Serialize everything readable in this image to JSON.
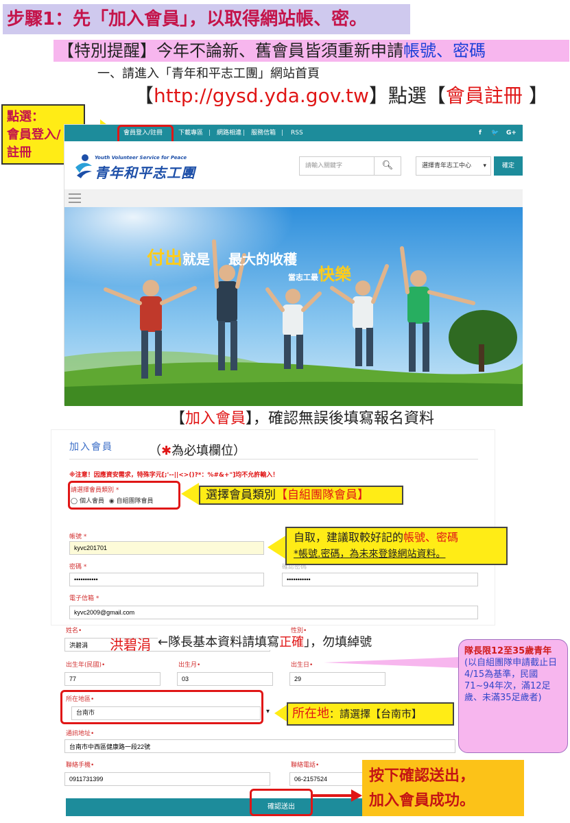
{
  "header": {
    "step_title": "步驟1：先「加入會員」，以取得網站帳、密。",
    "notice_prefix": "【特別提醒】今年不論新、舊會員皆須重新申請",
    "notice_highlight": "帳號、密碼",
    "instruction_1": "一、請進入「青年和平志工團」網站首頁",
    "url_open": "【",
    "url": "http://gysd.yda.gov.tw",
    "url_close": "】點選【",
    "register_label": "會員註冊",
    "register_close": " 】"
  },
  "callout_login": {
    "line1": "點選：",
    "line2": "會員登入/",
    "line3": "註冊"
  },
  "site": {
    "nav": [
      "會員登入/註冊",
      "下載專區",
      "網路相連",
      "服務信箱",
      "RSS"
    ],
    "social": [
      "f",
      "🐦",
      "G+"
    ],
    "logo_sub": "Youth Volunteer Service for Peace",
    "logo_text": "青年和平志工團",
    "search_placeholder": "請輸入關鍵字",
    "center_select": "選擇青年志工中心",
    "confirm": "確定",
    "slogan_1": "付出",
    "slogan_2": "就是",
    "slogan_3": "最大的收穫",
    "slogan_4": "當志工最",
    "slogan_5": "快樂"
  },
  "form_section": {
    "title_open": "【",
    "title_red": "加入會員",
    "title_rest": "】，確認無誤後填寫報名資料",
    "form_head": "加入會員",
    "required_note_open": "（",
    "required_note": "為必填欄位）",
    "warning": "※注意！因應資安需求，特殊字元[;'--||<>()?*：%#&+\"]均不允許輸入！",
    "member_type_label": "請選擇會員類別",
    "radio_individual": "個人會員",
    "radio_team": "自組團隊會員",
    "account_label": "帳號",
    "account_value": "kyvc201701",
    "password_label": "密碼",
    "password_value": "•••••••••••",
    "confirm_password_label": "確認密碼",
    "confirm_password_value": "•••••••••••",
    "email_label": "電子信箱",
    "email_value": "kyvc2009@gmail.com"
  },
  "callouts": {
    "member_type_1": "選擇會員類別",
    "member_type_2": "【自組團隊會員】",
    "account_1": "自取，建議取較好記的",
    "account_2": "帳號、密碼",
    "account_3": "*帳號.密碼，為未來登錄網站資料。",
    "name_red": "洪碧涓",
    "name_note_1": "←隊長基本資料請填寫",
    "name_note_2": "正確",
    "name_note_3": "」，勿填綽號",
    "location_1": "所在地",
    "location_2": "：請選擇【台南市】",
    "bubble_1": "隊長",
    "bubble_2": "限12至35歲青年",
    "bubble_3": "(以自組團隊申請截止日4/15為基準，民國71~94年次，滿12足歲、未滿35足歲者)",
    "final_1": "按下確認送出，",
    "final_2": "加入會員成功。"
  },
  "lower_form": {
    "name_label": "姓名",
    "name_value": "洪碧涓",
    "gender_label": "性別",
    "year_label": "出生年(民國)",
    "year_value": "77",
    "month_label": "出生月",
    "month_value": "03",
    "day_label": "出生日",
    "day_value": "29",
    "region_label": "所在地區",
    "region_value": "台南市",
    "address_label": "通訊地址",
    "address_value": "台南市中西區健康路一段22號",
    "mobile_label": "聯絡手機",
    "mobile_value": "0911731399",
    "phone_label": "聯絡電話",
    "phone_value": "06-2157524",
    "submit": "確認送出"
  },
  "colors": {
    "teal": "#1d8c9b",
    "red": "#e01616",
    "yellow": "#ffec16",
    "pink": "#f7b6ee",
    "lavender": "#cfc9ee"
  }
}
